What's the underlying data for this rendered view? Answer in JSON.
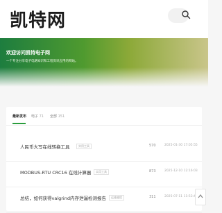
{
  "site": {
    "logo": "凯特网"
  },
  "search": {
    "icon": "search-icon"
  },
  "hero": {
    "title": "欢迎访问凯特电子网",
    "subtitle": "一个专注分享电子电路知识和工程资讯应用的网站。"
  },
  "tabs": [
    {
      "label": "最新发布",
      "count": ""
    },
    {
      "label": "电子",
      "count": "71"
    },
    {
      "label": "全部",
      "count": "151"
    }
  ],
  "articles": [
    {
      "title": "人民币大写在线转换工具",
      "badge": "实用工具",
      "views": "570",
      "date": "2025-01-30 17:05:55"
    },
    {
      "title": "MODBUS-RTU CRC16 在线计算器",
      "badge": "实用工具",
      "views": "873",
      "date": "2025-12-10 12:16:03"
    },
    {
      "title": "总结，如何获得valgrind内存泄漏检测报告",
      "badge": "运维编程",
      "views": "311",
      "date": "2025-07-11 11:53:42"
    }
  ],
  "colors": {
    "accent": "#2a9d3c",
    "hero_start": "#1d7d3f",
    "hero_end": "#c9c58a"
  }
}
